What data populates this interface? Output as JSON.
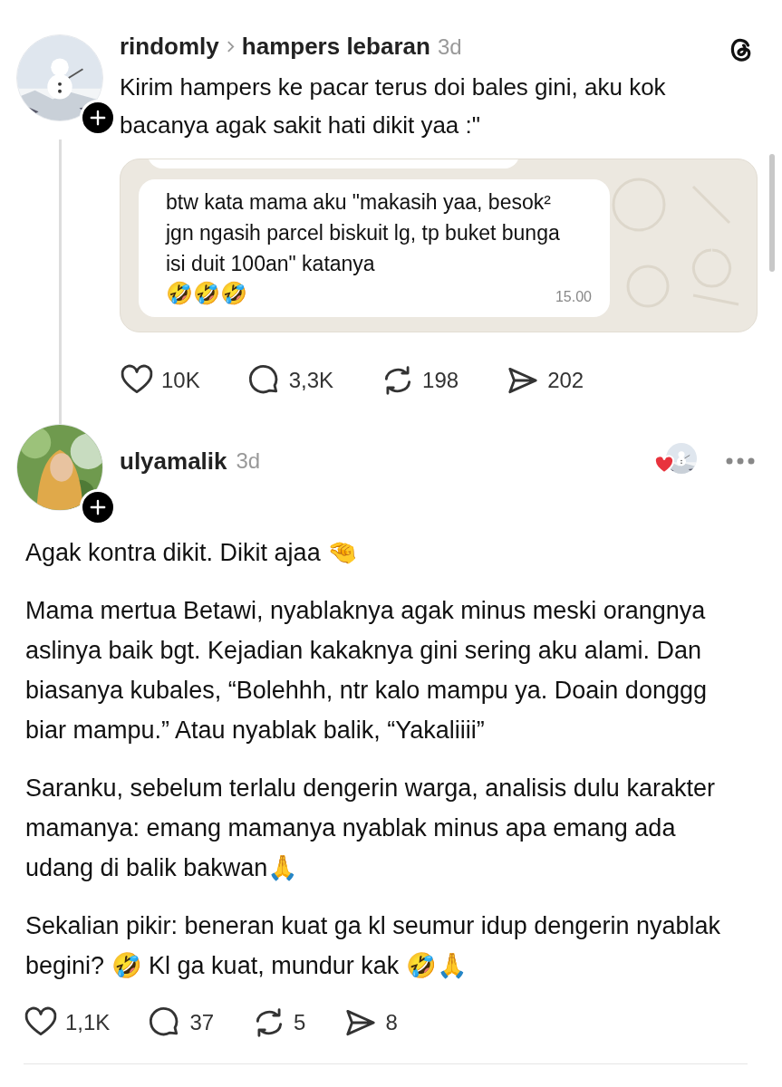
{
  "posts": [
    {
      "username": "rindomly",
      "topic": "hampers lebaran",
      "time": "3d",
      "text": "Kirim hampers ke pacar terus doi bales gini, aku kok bacanya agak sakit hati dikit yaa :\"",
      "attachment": {
        "kind": "chat",
        "message": "btw kata mama aku \"makasih yaa, besok² jgn ngasih parcel biskuit lg, tp buket bunga isi duit 100an\" katanya",
        "emoji": "🤣🤣🤣",
        "time": "15.00"
      },
      "stats": {
        "likes": "10K",
        "replies": "3,3K",
        "reposts": "198",
        "shares": "202"
      }
    },
    {
      "username": "ulyamalik",
      "time": "3d",
      "liked_by_author": true,
      "paragraphs": [
        "Agak kontra dikit. Dikit ajaa 🤏",
        "Mama mertua Betawi, nyablaknya agak minus meski orangnya aslinya baik bgt. Kejadian kakaknya gini sering aku alami. Dan biasanya kubales, “Bolehhh, ntr kalo mampu ya. Doain donggg biar mampu.” Atau nyablak balik, “Yakaliiii”",
        "Saranku, sebelum terlalu dengerin warga, analisis dulu karakter mamanya: emang mamanya nyablak minus apa emang ada udang di balik bakwan🙏",
        "Sekalian pikir: beneran kuat ga kl seumur idup dengerin nyablak begini? 🤣 Kl ga kuat, mundur kak 🤣🙏"
      ],
      "stats": {
        "likes": "1,1K",
        "replies": "37",
        "reposts": "5",
        "shares": "8"
      }
    }
  ]
}
